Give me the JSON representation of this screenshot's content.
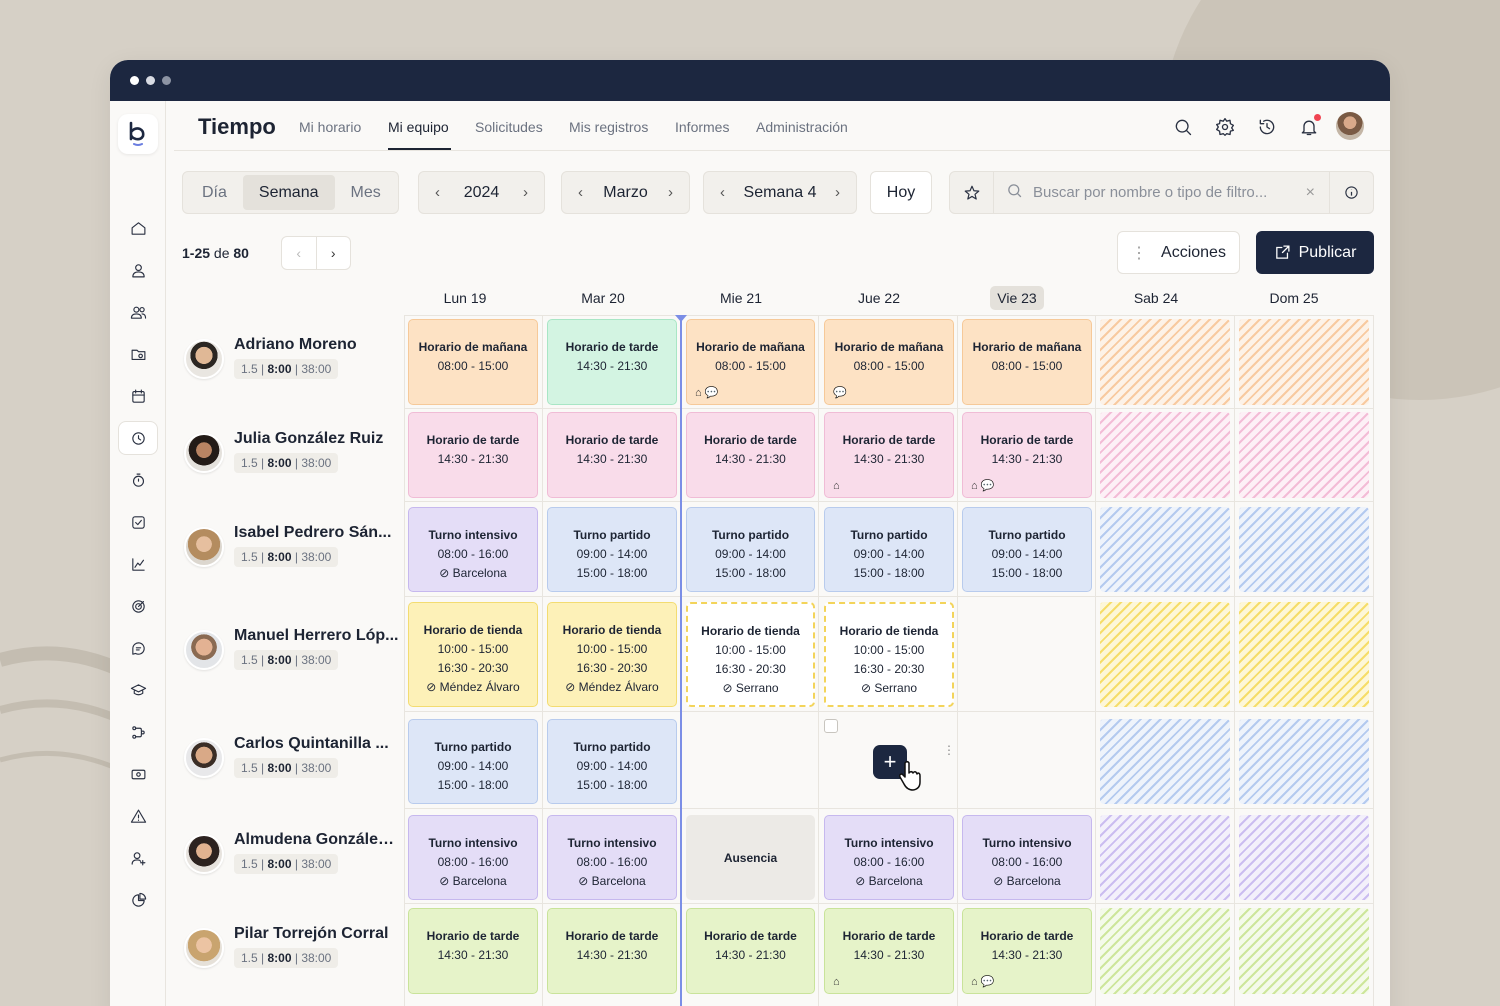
{
  "app": {
    "title": "Tiempo"
  },
  "nav": [
    "Mi horario",
    "Mi equipo",
    "Solicitudes",
    "Mis registros",
    "Informes",
    "Administración"
  ],
  "view_toggle": [
    "Día",
    "Semana",
    "Mes"
  ],
  "year": "2024",
  "month": "Marzo",
  "week": "Semana 4",
  "today_button": "Hoy",
  "search": {
    "placeholder": "Buscar por nombre o tipo de filtro..."
  },
  "pager": {
    "range": "1-25",
    "of": "de",
    "total": "80"
  },
  "actions": {
    "acciones": "Acciones",
    "publicar": "Publicar"
  },
  "days": [
    "Lun 19",
    "Mar 20",
    "Mie 21",
    "Jue 22",
    "Vie 23",
    "Sab 24",
    "Dom 25"
  ],
  "employees": [
    {
      "name": "Adriano Moreno",
      "stats": [
        "1.5",
        "8:00",
        "38:00"
      ]
    },
    {
      "name": "Julia González Ruiz",
      "stats": [
        "1.5",
        "8:00",
        "38:00"
      ]
    },
    {
      "name": "Isabel Pedrero Sán...",
      "stats": [
        "1.5",
        "8:00",
        "38:00"
      ]
    },
    {
      "name": "Manuel Herrero Lóp...",
      "stats": [
        "1.5",
        "8:00",
        "38:00"
      ]
    },
    {
      "name": "Carlos Quintanilla ...",
      "stats": [
        "1.5",
        "8:00",
        "38:00"
      ]
    },
    {
      "name": "Almudena González...",
      "stats": [
        "1.5",
        "8:00",
        "38:00"
      ]
    },
    {
      "name": "Pilar Torrejón Corral",
      "stats": [
        "1.5",
        "8:00",
        "38:00"
      ]
    }
  ],
  "shift_texts": {
    "manana": "Horario de mañana",
    "tarde": "Horario de tarde",
    "intensivo": "Turno intensivo",
    "partido": "Turno partido",
    "tienda": "Horario de tienda",
    "ausencia": "Ausencia",
    "t_0800_1500": "08:00 - 15:00",
    "t_1430_2130": "14:30 - 21:30",
    "t_0800_1600": "08:00 - 16:00",
    "t_0900_1400": "09:00 - 14:00",
    "t_1500_1800": "15:00 - 18:00",
    "t_1000_1500": "10:00 - 15:00",
    "t_1630_2030": "16:30 - 20:30",
    "loc_barcelona": "Barcelona",
    "loc_mendez": "Méndez Álvaro",
    "loc_serrano": "Serrano"
  },
  "colors": {
    "accent": "#1c2740",
    "now_line": "#7b8ee6",
    "notification": "#f04452"
  }
}
